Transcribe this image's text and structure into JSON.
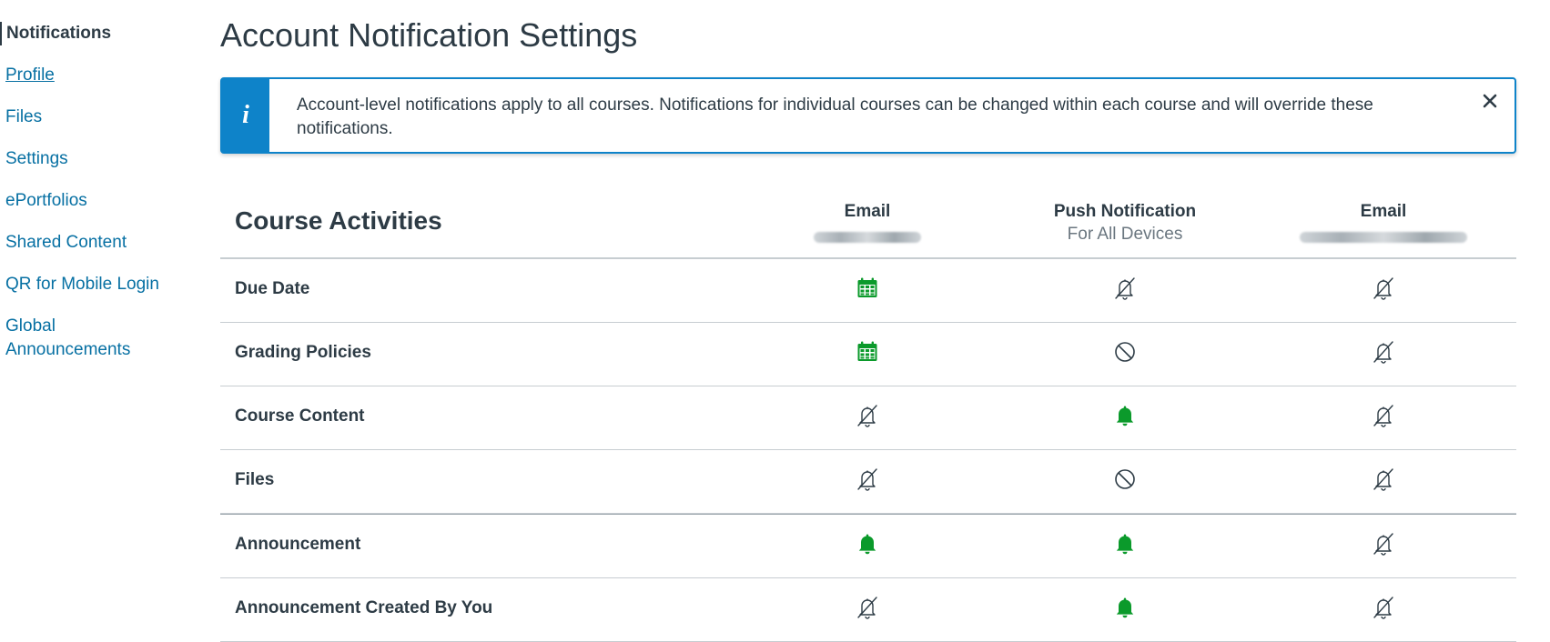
{
  "sidebar": {
    "items": [
      {
        "label": "Notifications",
        "state": "active"
      },
      {
        "label": "Profile",
        "state": "hover"
      },
      {
        "label": "Files"
      },
      {
        "label": "Settings"
      },
      {
        "label": "ePortfolios"
      },
      {
        "label": "Shared Content"
      },
      {
        "label": "QR for Mobile Login"
      },
      {
        "label": "Global Announcements"
      }
    ]
  },
  "page": {
    "title": "Account Notification Settings"
  },
  "alert": {
    "icon": "info-icon",
    "icon_glyph": "i",
    "text": "Account-level notifications apply to all courses. Notifications for individual courses can be changed within each course and will override these notifications.",
    "close_glyph": "✕"
  },
  "table": {
    "section_title": "Course Activities",
    "columns": [
      {
        "title": "Email",
        "subtitle": ""
      },
      {
        "title": "Push Notification",
        "subtitle": "For All Devices"
      },
      {
        "title": "Email",
        "subtitle": ""
      }
    ],
    "rows": [
      {
        "label": "Due Date",
        "settings": [
          "daily",
          "off",
          "off"
        ]
      },
      {
        "label": "Grading Policies",
        "settings": [
          "daily",
          "disabled",
          "off"
        ]
      },
      {
        "label": "Course Content",
        "settings": [
          "off",
          "immediately",
          "off"
        ]
      },
      {
        "label": "Files",
        "settings": [
          "off",
          "disabled",
          "off"
        ]
      },
      {
        "label": "Announcement",
        "settings": [
          "immediately",
          "immediately",
          "off"
        ]
      },
      {
        "label": "Announcement Created By You",
        "settings": [
          "off",
          "immediately",
          "off"
        ]
      }
    ]
  },
  "colors": {
    "link": "#0770a3",
    "accent": "#0e83c9",
    "success": "#0b9a2b",
    "text": "#2d3b45"
  },
  "icons": {
    "daily": "calendar-icon",
    "off": "bell-off-icon",
    "immediately": "bell-icon",
    "disabled": "blocked-icon"
  }
}
